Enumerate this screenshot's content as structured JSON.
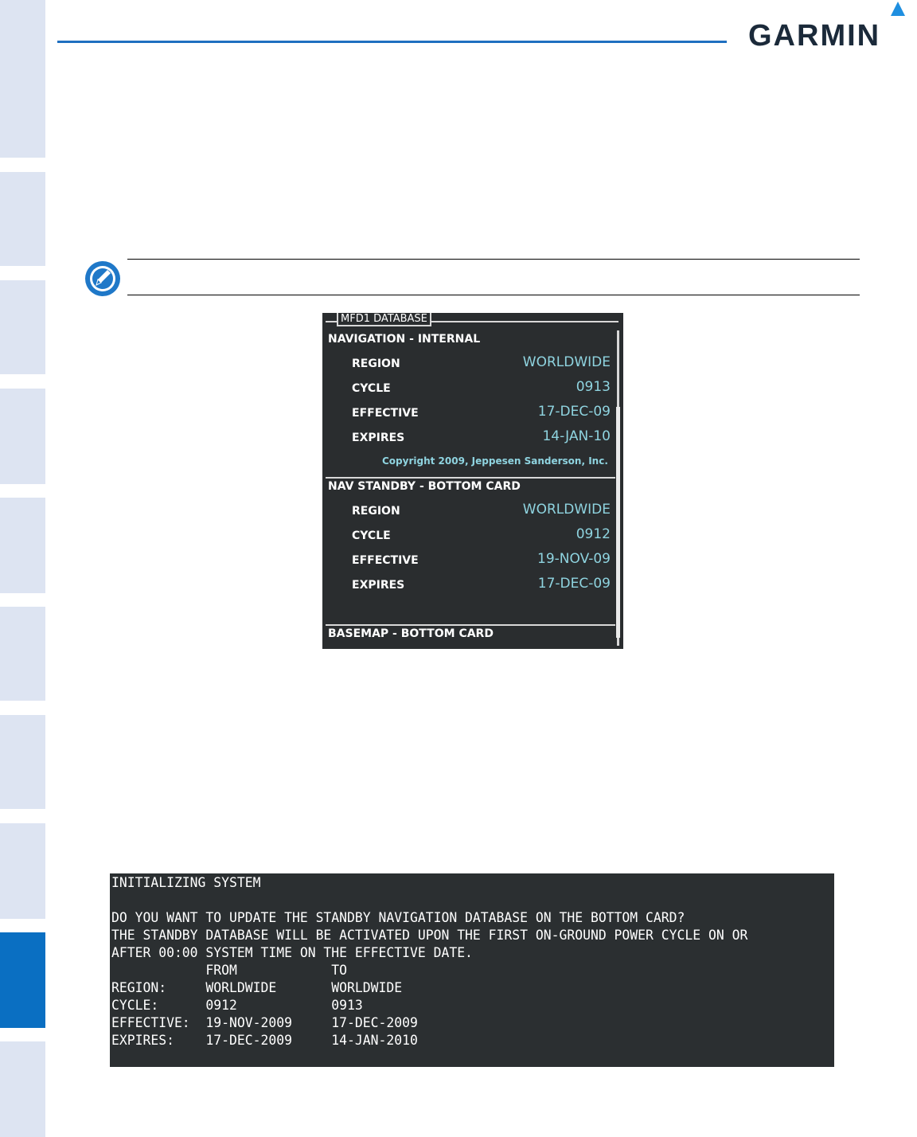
{
  "header": {
    "brand": "GARMIN"
  },
  "mfd_panel": {
    "title": "MFD1 DATABASE",
    "sections": [
      {
        "heading": "NAVIGATION - INTERNAL",
        "rows": [
          {
            "label": "REGION",
            "value": "WORLDWIDE"
          },
          {
            "label": "CYCLE",
            "value": "0913"
          },
          {
            "label": "EFFECTIVE",
            "value": "17-DEC-09"
          },
          {
            "label": "EXPIRES",
            "value": "14-JAN-10"
          }
        ],
        "copyright": "Copyright 2009, Jeppesen Sanderson, Inc."
      },
      {
        "heading": "NAV STANDBY - BOTTOM CARD",
        "rows": [
          {
            "label": "REGION",
            "value": "WORLDWIDE"
          },
          {
            "label": "CYCLE",
            "value": "0912"
          },
          {
            "label": "EFFECTIVE",
            "value": "19-NOV-09"
          },
          {
            "label": "EXPIRES",
            "value": "17-DEC-09"
          }
        ]
      },
      {
        "heading": "BASEMAP - BOTTOM CARD"
      }
    ]
  },
  "terminal": {
    "lines": [
      "INITIALIZING SYSTEM",
      "",
      "DO YOU WANT TO UPDATE THE STANDBY NAVIGATION DATABASE ON THE BOTTOM CARD?",
      "THE STANDBY DATABASE WILL BE ACTIVATED UPON THE FIRST ON-GROUND POWER CYCLE ON OR",
      "AFTER 00:00 SYSTEM TIME ON THE EFFECTIVE DATE.",
      "            FROM            TO",
      "REGION:     WORLDWIDE       WORLDWIDE",
      "CYCLE:      0912            0913",
      "EFFECTIVE:  19-NOV-2009     17-DEC-2009",
      "EXPIRES:    17-DEC-2009     14-JAN-2010"
    ]
  },
  "colors": {
    "tab_inactive": "#dde4f2",
    "tab_active": "#0a6fc2",
    "header_rule": "#1f6fc0",
    "mfd_value": "#8fd4e0",
    "panel_bg": "#2a2d2f"
  },
  "icons": {
    "note": "note-pencil-icon",
    "logo_mark": "garmin-triangle-icon"
  }
}
